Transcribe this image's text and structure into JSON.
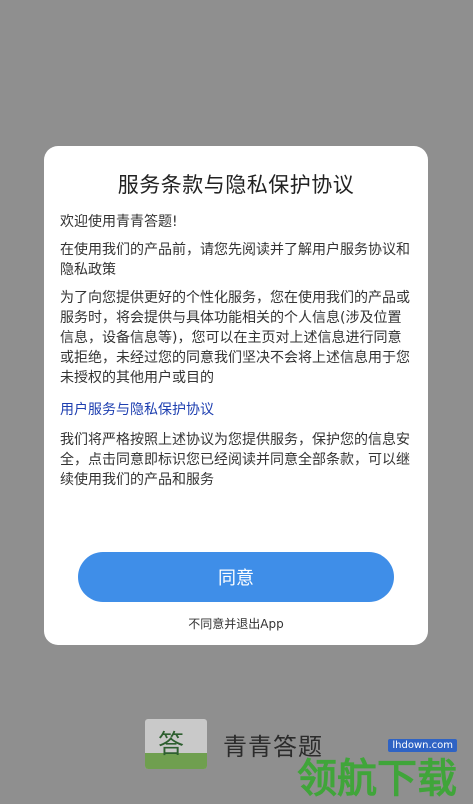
{
  "dialog": {
    "title": "服务条款与隐私保护协议",
    "paragraphs": [
      "欢迎使用青青答题!",
      "在使用我们的产品前，请您先阅读并了解用户服务协议和隐私政策",
      "为了向您提供更好的个性化服务，您在使用我们的产品或服务时，将会提供与具体功能相关的个人信息(涉及位置信息，设备信息等)，您可以在主页对上述信息进行同意或拒绝，未经过您的同意我们坚决不会将上述信息用于您未授权的其他用户或目的"
    ],
    "policy_link": "用户服务与隐私保护协议",
    "closing_paragraph": "我们将严格按照上述协议为您提供服务，保护您的信息安全，点击同意即标识您已经阅读并同意全部条款，可以继续使用我们的产品和服务",
    "agree_label": "同意",
    "disagree_label": "不同意并退出App"
  },
  "brand": {
    "logo_char": "答",
    "name": "青青答题"
  },
  "watermark": {
    "domain": "lhdown.com",
    "text": "领航下载"
  },
  "colors": {
    "overlay": "#8f8f8f",
    "accent": "#3f8ee8",
    "link": "#1e3fb0",
    "watermark_green": "#40a53a"
  }
}
